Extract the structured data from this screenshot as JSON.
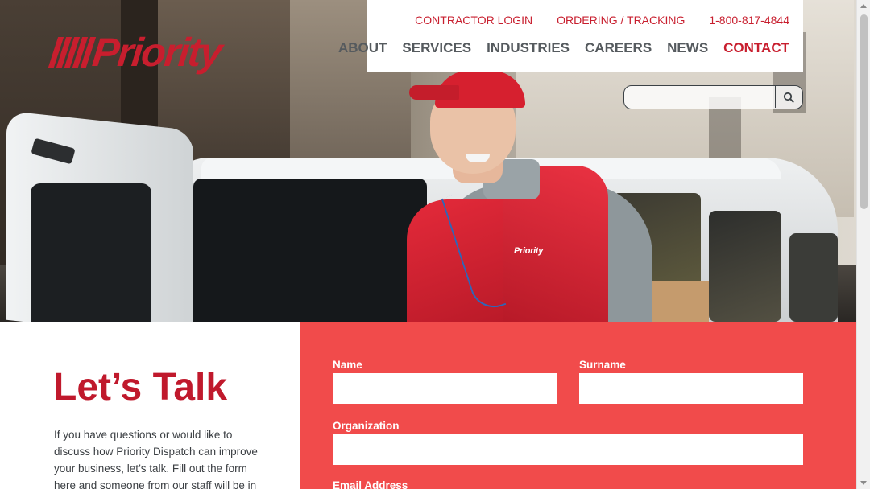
{
  "brand": {
    "logo_text": "Priority",
    "accent_color": "#c81e2e",
    "form_color": "#f14b4b"
  },
  "utility_nav": {
    "contractor_login": "CONTRACTOR LOGIN",
    "ordering_tracking": "ORDERING / TRACKING",
    "phone": "1-800-817-4844"
  },
  "main_nav": {
    "items": [
      {
        "label": "ABOUT"
      },
      {
        "label": "SERVICES"
      },
      {
        "label": "INDUSTRIES"
      },
      {
        "label": "CAREERS"
      },
      {
        "label": "NEWS"
      },
      {
        "label": "CONTACT",
        "active": true
      }
    ]
  },
  "search": {
    "value": "",
    "placeholder": "",
    "icon": "search-icon"
  },
  "hero": {
    "vest_logo": "Priority"
  },
  "contact": {
    "heading": "Let’s Talk",
    "intro": "If you have questions or would like to discuss how Priority Dispatch can improve your business, let’s talk. Fill out the form here and someone from our staff will be in"
  },
  "form": {
    "name_label": "Name",
    "surname_label": "Surname",
    "organization_label": "Organization",
    "email_label": "Email Address",
    "name_value": "",
    "surname_value": "",
    "organization_value": ""
  }
}
